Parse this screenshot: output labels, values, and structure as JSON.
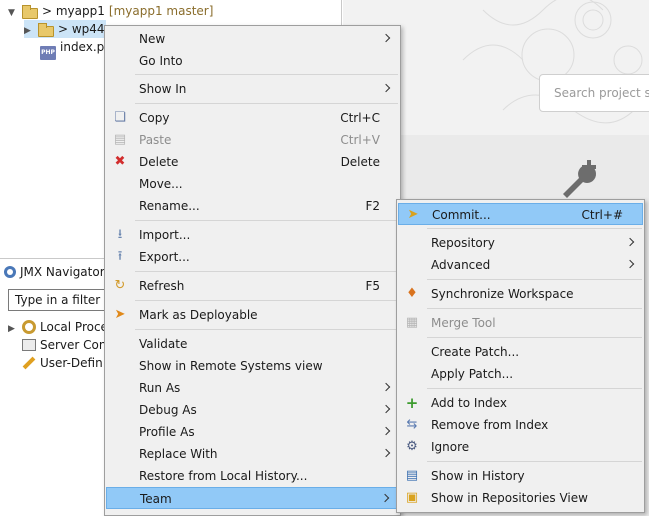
{
  "explorer": {
    "rows": [
      {
        "label": "> myapp1",
        "decoration": "[myapp1 master]"
      },
      {
        "label": "> wp44"
      },
      {
        "label": "index.p"
      }
    ]
  },
  "editor": {
    "search_placeholder": "Search project st"
  },
  "jmx": {
    "title": "JMX Navigator",
    "filter_placeholder": "Type in a filter",
    "items": [
      "Local Proce",
      "Server Con",
      "User-Defin"
    ]
  },
  "context_menu": {
    "items": [
      {
        "label": "New",
        "submenu": true
      },
      {
        "label": "Go Into"
      },
      {
        "label": "Show In",
        "submenu": true
      },
      {
        "label": "Copy",
        "shortcut": "Ctrl+C"
      },
      {
        "label": "Paste",
        "shortcut": "Ctrl+V"
      },
      {
        "label": "Delete",
        "shortcut": "Delete"
      },
      {
        "label": "Move..."
      },
      {
        "label": "Rename...",
        "shortcut": "F2"
      },
      {
        "label": "Import..."
      },
      {
        "label": "Export..."
      },
      {
        "label": "Refresh",
        "shortcut": "F5"
      },
      {
        "label": "Mark as Deployable"
      },
      {
        "label": "Validate"
      },
      {
        "label": "Show in Remote Systems view"
      },
      {
        "label": "Run As",
        "submenu": true
      },
      {
        "label": "Debug As",
        "submenu": true
      },
      {
        "label": "Profile As",
        "submenu": true
      },
      {
        "label": "Replace With",
        "submenu": true
      },
      {
        "label": "Restore from Local History..."
      },
      {
        "label": "Team",
        "submenu": true
      }
    ]
  },
  "team_menu": {
    "items": [
      {
        "label": "Commit...",
        "shortcut": "Ctrl+#"
      },
      {
        "label": "Repository",
        "submenu": true
      },
      {
        "label": "Advanced",
        "submenu": true
      },
      {
        "label": "Synchronize Workspace"
      },
      {
        "label": "Merge Tool"
      },
      {
        "label": "Create Patch..."
      },
      {
        "label": "Apply Patch..."
      },
      {
        "label": "Add to Index"
      },
      {
        "label": "Remove from Index"
      },
      {
        "label": "Ignore"
      },
      {
        "label": "Show in History"
      },
      {
        "label": "Show in Repositories View"
      }
    ]
  },
  "colors": {
    "menu_bg": "#f0f0f0",
    "highlight": "#91c9f7",
    "disabled_text": "#8d8d8d"
  }
}
